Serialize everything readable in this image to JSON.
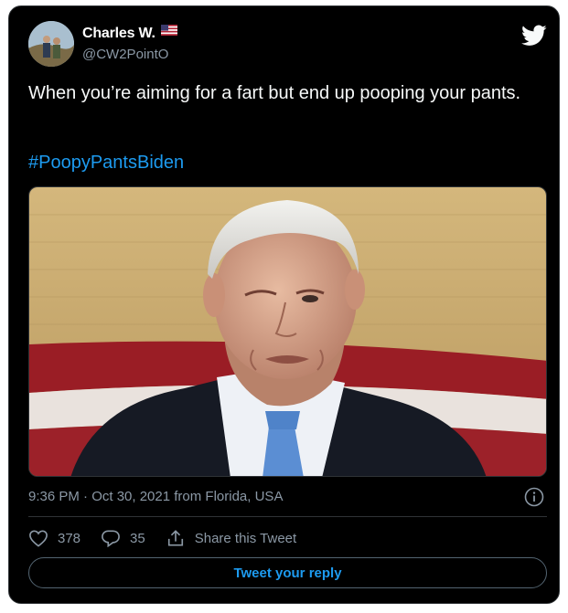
{
  "tweet": {
    "author_name": "Charles W.",
    "author_handle": "@CW2PointO",
    "text": "When you’re aiming for a fart but end up pooping your pants.",
    "hashtag": "#PoopyPantsBiden",
    "timestamp_location": "9:36 PM · Oct 30, 2021 from Florida, USA",
    "likes": "378",
    "replies": "35",
    "share_label": "Share this Tweet",
    "reply_button_label": "Tweet your reply"
  },
  "icons": {
    "platform": "twitter-bird-icon",
    "badge": "us-flag-icon",
    "info": "info-icon",
    "like": "heart-icon",
    "reply": "reply-bubble-icon",
    "share": "share-icon"
  },
  "colors": {
    "background": "#000000",
    "text": "#f7f9f9",
    "secondary": "#8b98a5",
    "accent": "#1d9bf0",
    "border": "#2f3336"
  }
}
